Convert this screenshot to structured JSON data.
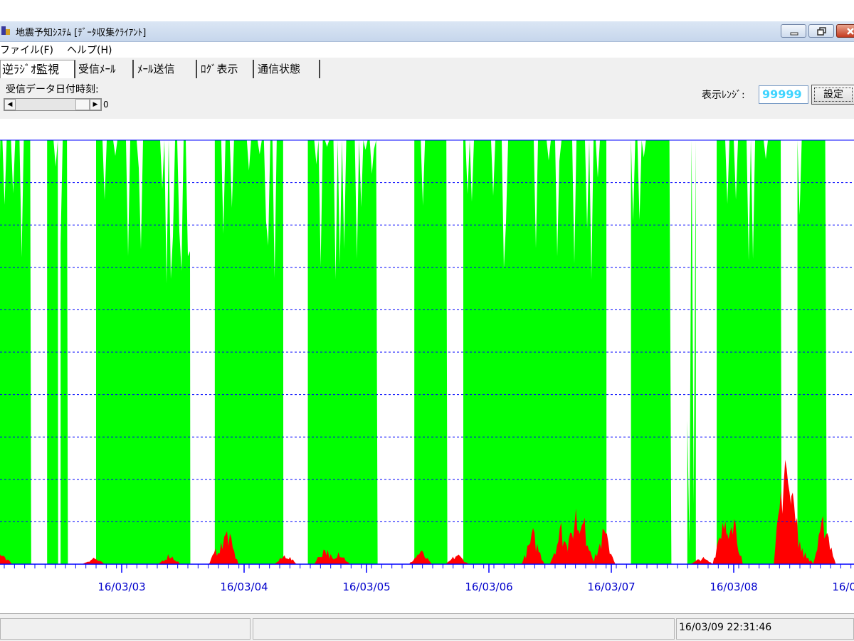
{
  "window": {
    "title": "地震予知ｼｽﾃﾑ [ﾃﾞｰﾀ収集ｸﾗｲｱﾝﾄ]",
    "controls": [
      "minimize",
      "maximize",
      "close"
    ]
  },
  "menu": {
    "items": [
      "ファイル(F)",
      "ヘルプ(H)"
    ]
  },
  "tabs": [
    "逆ﾗｼﾞｵ監視",
    "受信ﾒｰﾙ",
    "ﾒｰﾙ送信",
    "ﾛｸﾞ表示",
    "通信状態"
  ],
  "active_tab": 0,
  "received": {
    "label": "受信データ日付時刻:",
    "scroll_value": "0"
  },
  "range": {
    "label": "表示ﾚﾝｼﾞ:",
    "value": "99999",
    "set_button": "設定"
  },
  "colors": {
    "green": "#00ff00",
    "red": "#ff0000",
    "axis": "#0000ff",
    "label": "#0000cc"
  },
  "chart_data": {
    "type": "area",
    "x_tick_labels": [
      "16/03/03",
      "16/03/04",
      "16/03/05",
      "16/03/06",
      "16/03/07",
      "16/03/08",
      "16/03/09"
    ],
    "ylim": [
      0,
      99999
    ],
    "grid": true,
    "series": [
      {
        "color": "#00ff00",
        "segments": [
          [
            2.95,
            3.22,
            0.95
          ],
          [
            3.35,
            3.44,
            0.8
          ],
          [
            3.46,
            3.52,
            0.72
          ],
          [
            3.75,
            4.52,
            0.96
          ],
          [
            4.72,
            5.28,
            0.93
          ],
          [
            5.48,
            6.05,
            0.88
          ],
          [
            6.35,
            6.62,
            0.94
          ],
          [
            6.75,
            7.92,
            0.97
          ],
          [
            8.12,
            8.45,
            0.96
          ],
          [
            8.58,
            8.65,
            0.12
          ],
          [
            8.82,
            9.35,
            0.96
          ],
          [
            9.48,
            9.72,
            0.98
          ]
        ]
      },
      {
        "color": "#ff0000",
        "peaks": [
          [
            2.97,
            0.04
          ],
          [
            3.73,
            0.02
          ],
          [
            4.35,
            0.03
          ],
          [
            4.76,
            0.06
          ],
          [
            4.82,
            0.1
          ],
          [
            5.3,
            0.03
          ],
          [
            5.62,
            0.05
          ],
          [
            5.73,
            0.04
          ],
          [
            6.4,
            0.04
          ],
          [
            6.7,
            0.03
          ],
          [
            7.32,
            0.09
          ],
          [
            7.55,
            0.11
          ],
          [
            7.67,
            0.16
          ],
          [
            7.73,
            0.13
          ],
          [
            7.9,
            0.1
          ],
          [
            8.7,
            0.02
          ],
          [
            8.88,
            0.16
          ],
          [
            8.94,
            0.19
          ],
          [
            9.38,
            0.36
          ],
          [
            9.43,
            0.24
          ],
          [
            9.52,
            0.04
          ],
          [
            9.7,
            0.14
          ]
        ]
      }
    ]
  },
  "status": {
    "panels": [
      "",
      ""
    ],
    "datetime": "16/03/09 22:31:46"
  }
}
